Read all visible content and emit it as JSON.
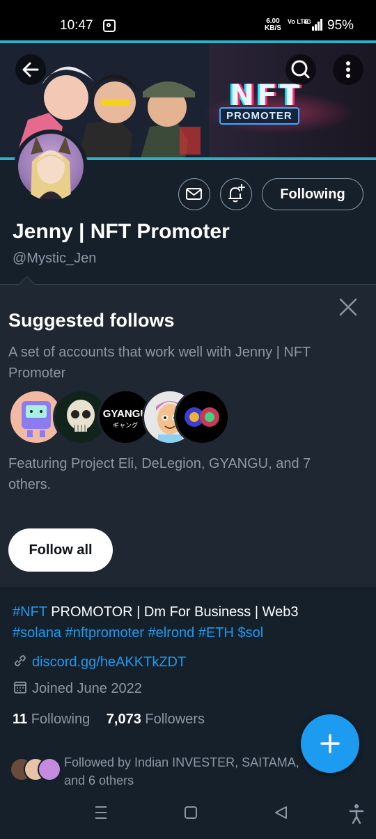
{
  "status_bar": {
    "time": "10:47",
    "net_speed_value": "6.00",
    "net_speed_unit": "KB/S",
    "volte": "Vo LTE",
    "signal": "4G",
    "battery": "95%"
  },
  "banner": {
    "brand_word": "NFT",
    "brand_sub": "PROMOTER"
  },
  "profile": {
    "name": "Jenny | NFT Promoter",
    "handle": "@Mystic_Jen",
    "following_button": "Following"
  },
  "suggested": {
    "title": "Suggested follows",
    "description": "A set of accounts that work well with Jenny | NFT Promoter",
    "avatar_text_gyangu": "GYANGU",
    "avatar_text_gyangu_sub": "ギャング",
    "featuring": "Featuring Project Eli, DeLegion, GYANGU, and 7 others.",
    "follow_all": "Follow all"
  },
  "bio": {
    "line1_tag": "#NFT",
    "line1_rest": " PROMOTOR | Dm For Business | Web3",
    "line2": "#solana #nftpromoter #elrond #ETH $sol",
    "link": "discord.gg/heAKKTkZDT",
    "joined": "Joined June 2022"
  },
  "stats": {
    "following_count": "11",
    "following_label": "Following",
    "followers_count": "7,073",
    "followers_label": "Followers"
  },
  "followed_by": "Followed by Indian INVESTER, SAITAMA, and 6 others",
  "colors": {
    "background": "#15202b",
    "card": "#1e2732",
    "accent": "#1d9bf0",
    "muted": "#8b98a5"
  }
}
